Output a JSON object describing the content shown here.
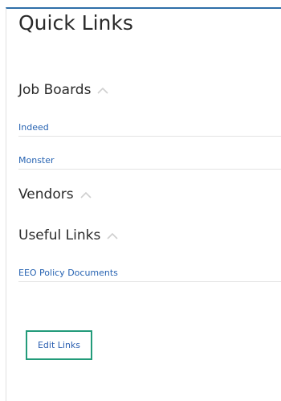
{
  "panel": {
    "title": "Quick Links"
  },
  "sections": [
    {
      "label": "Job Boards",
      "collapse_icon": "chevron-up-icon",
      "links": [
        "Indeed",
        "Monster"
      ]
    },
    {
      "label": "Vendors",
      "collapse_icon": "chevron-up-icon",
      "links": []
    },
    {
      "label": "Useful Links",
      "collapse_icon": "chevron-up-icon",
      "links": [
        "EEO Policy Documents"
      ]
    }
  ],
  "actions": {
    "edit_label": "Edit Links"
  },
  "colors": {
    "accent_top_border": "#2f6fa8",
    "link": "#2763b2",
    "button_border": "#239b7a"
  }
}
